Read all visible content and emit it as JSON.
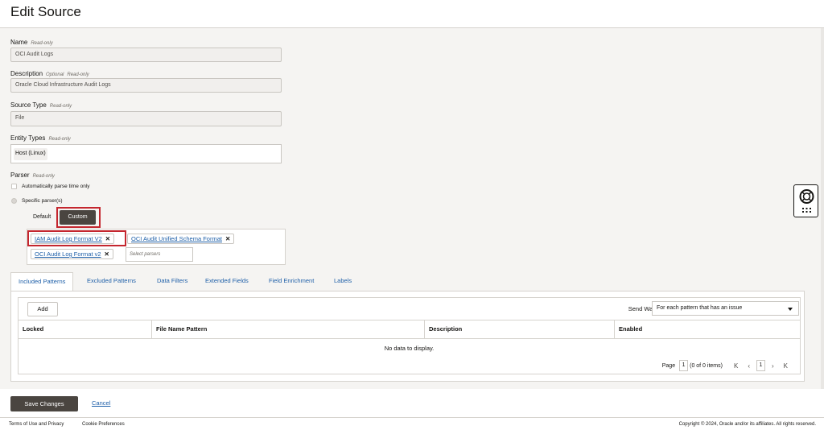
{
  "page": {
    "title": "Edit Source"
  },
  "form": {
    "name": {
      "label": "Name",
      "read_only": "Read-only",
      "value": "OCI Audit Logs"
    },
    "description": {
      "label": "Description",
      "optional": "Optional",
      "read_only": "Read-only",
      "value": "Oracle Cloud Infrastructure Audit Logs"
    },
    "source_type": {
      "label": "Source Type",
      "read_only": "Read-only",
      "value": "File"
    },
    "entity_types": {
      "label": "Entity Types",
      "read_only": "Read-only",
      "chip": "Host (Linux)"
    },
    "parser": {
      "label": "Parser",
      "read_only": "Read-only",
      "auto_parse_label": "Automatically parse time only",
      "specific_label": "Specific parser(s)",
      "mode_default": "Default",
      "mode_custom": "Custom",
      "selected": [
        "IAM Audit Log Format V2",
        "OCI Audit Unified Schema Format",
        "OCI Audit Log Format v2"
      ],
      "select_placeholder": "Select parsers"
    }
  },
  "tabs": [
    "Included Patterns",
    "Excluded Patterns",
    "Data Filters",
    "Extended Fields",
    "Field Enrichment",
    "Labels"
  ],
  "patterns": {
    "add_label": "Add",
    "send_warning_label": "Send Warning",
    "send_warning_value": "For each pattern that has an issue",
    "columns": [
      "Locked",
      "File Name Pattern",
      "Description",
      "Enabled"
    ],
    "empty_text": "No data to display.",
    "pager": {
      "page_label": "Page",
      "page_value": "1",
      "summary": "(0 of 0 items)",
      "current": "1"
    }
  },
  "actions": {
    "save": "Save Changes",
    "cancel": "Cancel"
  },
  "footer": {
    "terms": "Terms of Use and Privacy",
    "cookies": "Cookie Preferences",
    "copyright": "Copyright © 2024, Oracle and/or its affiliates. All rights reserved."
  },
  "colors": {
    "accent_link": "#1e5fa8",
    "primary_button": "#4a4540",
    "highlight_box": "#c4262e"
  }
}
